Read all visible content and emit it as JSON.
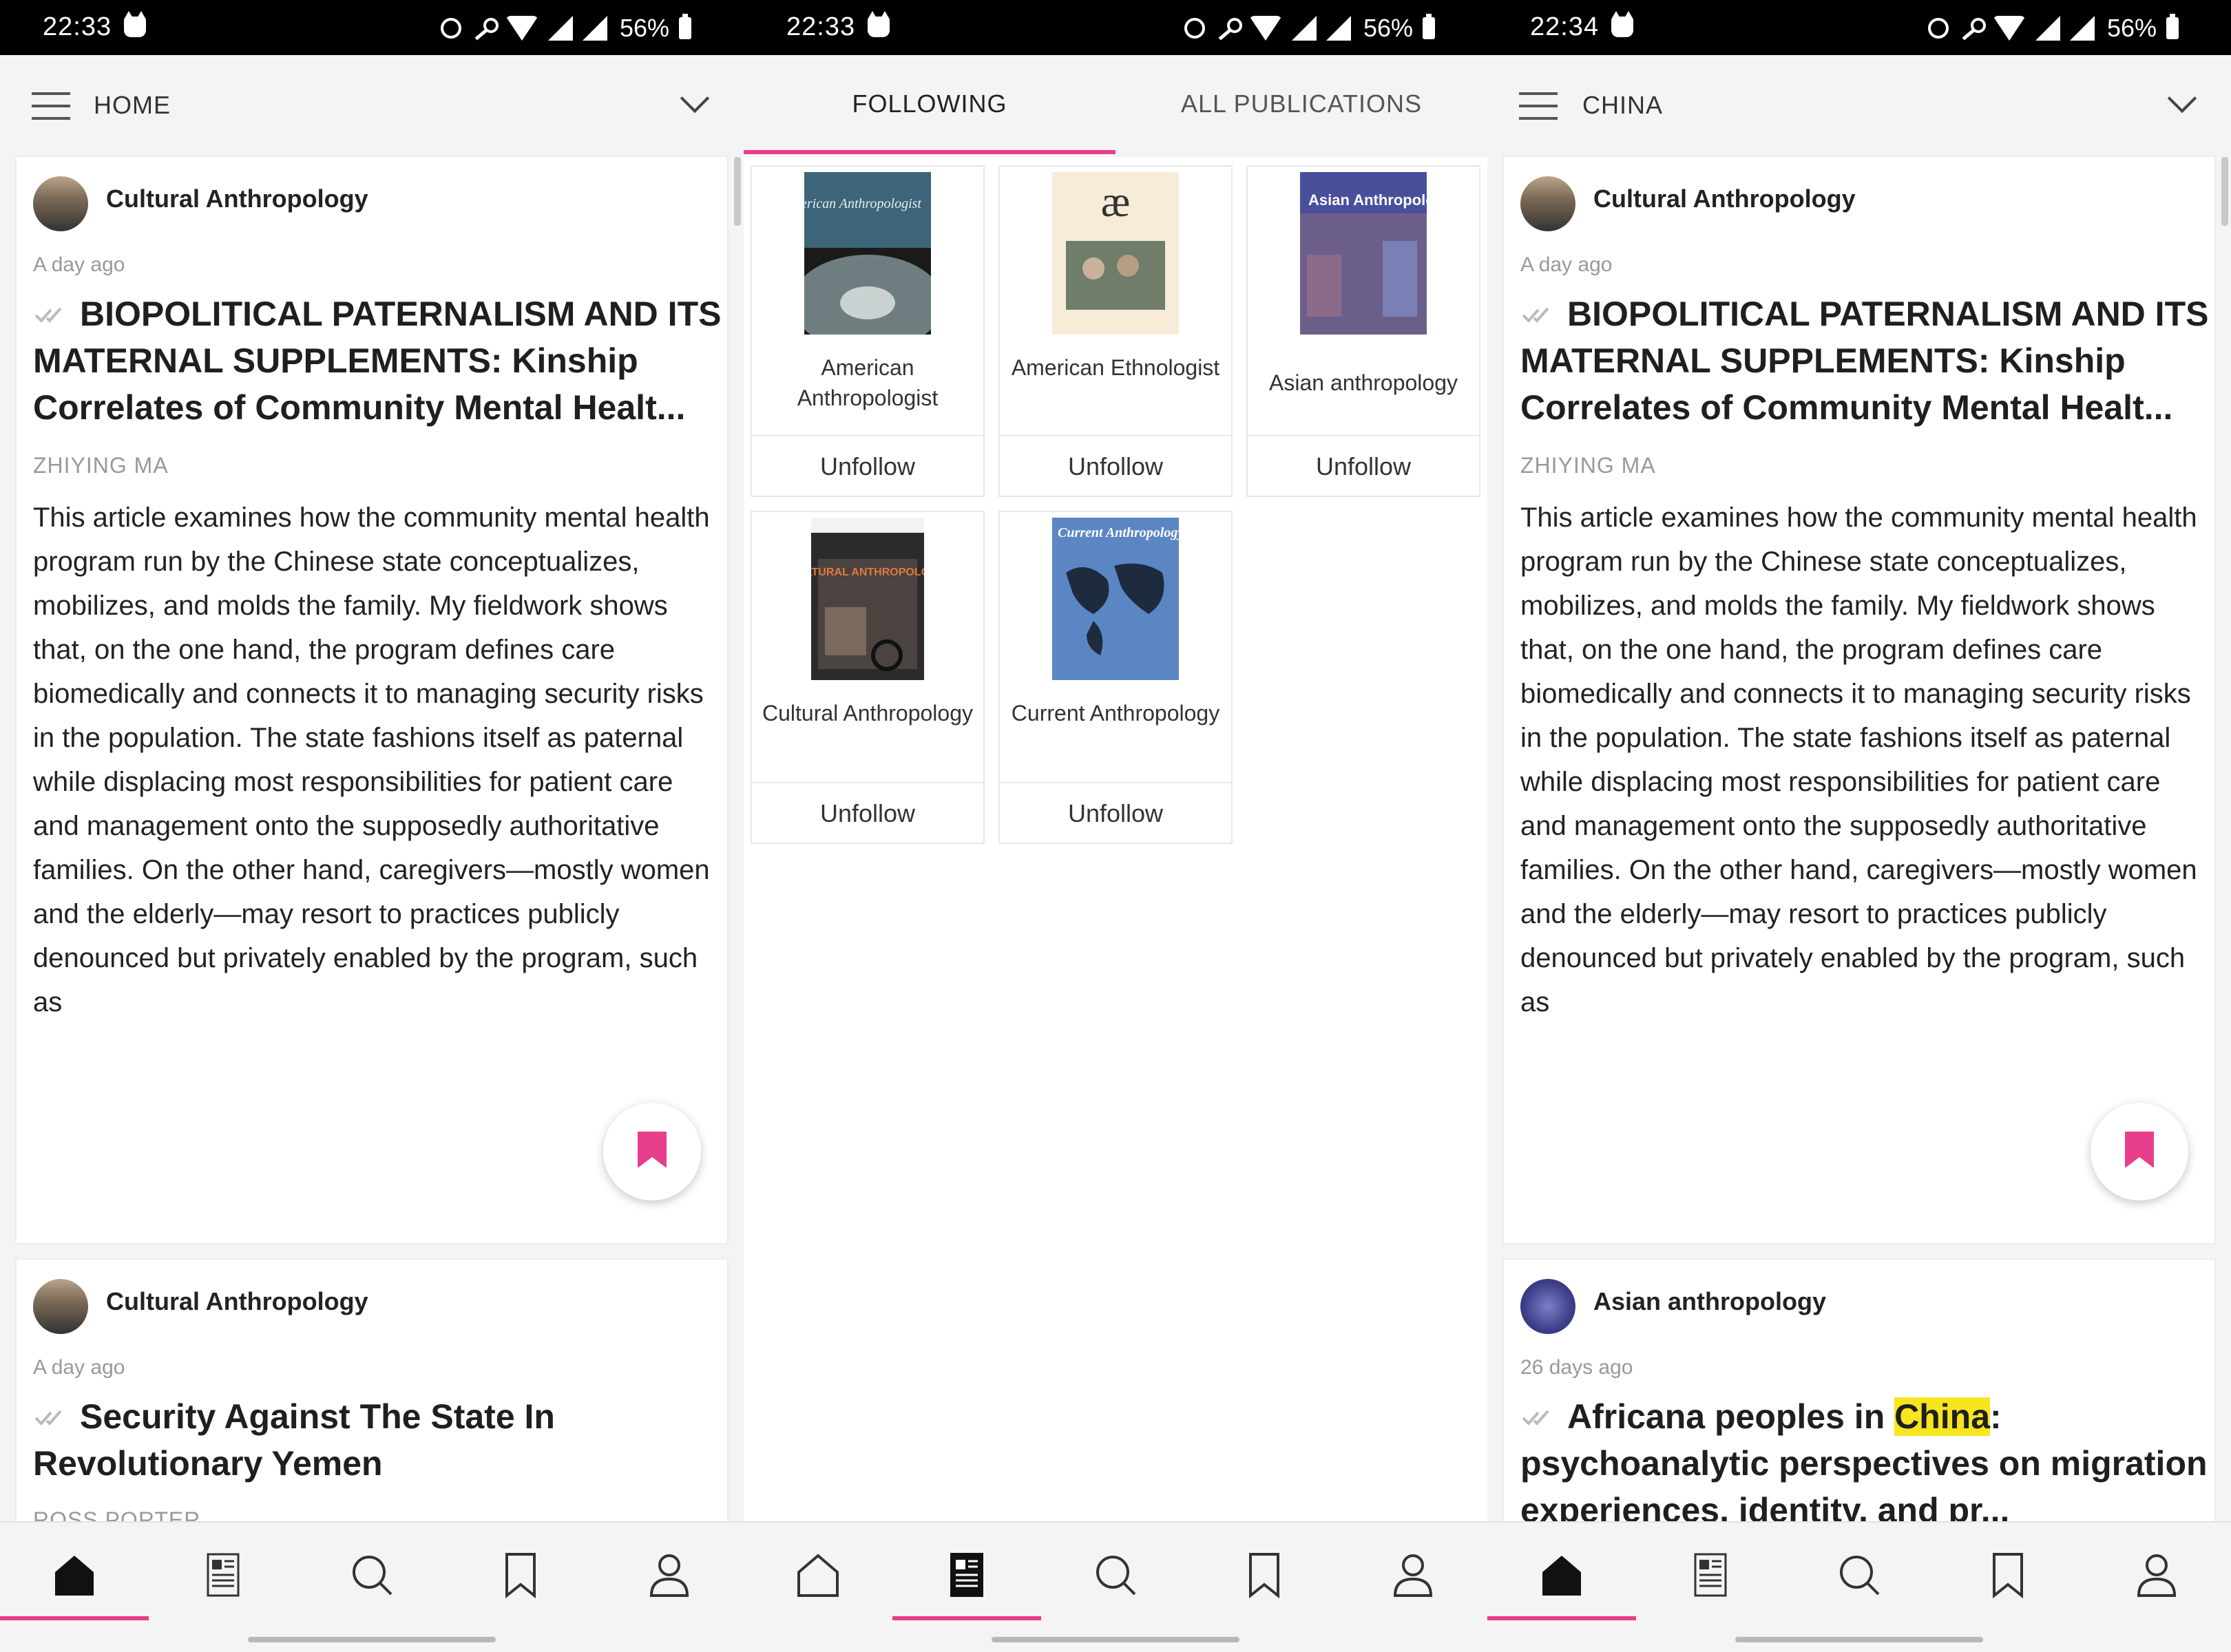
{
  "panel1": {
    "status": {
      "time": "22:33",
      "battery": "56%"
    },
    "appbar": {
      "title": "HOME"
    },
    "card1": {
      "publication": "Cultural Anthropology",
      "age": "A day ago",
      "title": "BIOPOLITICAL PATERNALISM AND ITS MATERNAL SUPPLEMENTS: Kinship Correlates of Community Mental Healt...",
      "author": "ZHIYING MA",
      "abstract": "This article examines how the community mental health program run by the Chinese state conceptualizes, mobilizes, and molds the family. My fieldwork shows that, on the one hand, the program defines care biomedically and connects it to managing security risks in the population. The state fashions itself as paternal while displacing most responsibilities for patient care and management onto the supposedly authoritative families. On the other hand, caregivers—mostly women and the elderly—may resort to practices publicly denounced but privately enabled by the program, such as"
    },
    "card2": {
      "publication": "Cultural Anthropology",
      "age": "A day ago",
      "title": "Security Against The State In Revolutionary Yemen",
      "author": "ROSS PORTER"
    },
    "nav_selected": "home"
  },
  "panel2": {
    "status": {
      "time": "22:33",
      "battery": "56%"
    },
    "tabs": {
      "following": "FOLLOWING",
      "all": "ALL PUBLICATIONS"
    },
    "tiles": [
      {
        "name": "American Anthropologist",
        "cover_text": "American Anthropologist",
        "action": "Unfollow"
      },
      {
        "name": "American Ethnologist",
        "cover_text": "æ",
        "action": "Unfollow"
      },
      {
        "name": "Asian anthropology",
        "cover_text": "Asian Anthropology",
        "action": "Unfollow"
      },
      {
        "name": "Cultural Anthropology",
        "cover_text": "CULTURAL ANTHROPOLOGY",
        "action": "Unfollow"
      },
      {
        "name": "Current Anthropology",
        "cover_text": "Current Anthropology",
        "action": "Unfollow"
      }
    ],
    "nav_selected": "publications"
  },
  "panel3": {
    "status": {
      "time": "22:34",
      "battery": "56%"
    },
    "appbar": {
      "title": "CHINA"
    },
    "card1": {
      "publication": "Cultural Anthropology",
      "age": "A day ago",
      "title": "BIOPOLITICAL PATERNALISM AND ITS MATERNAL SUPPLEMENTS: Kinship Correlates of Community Mental Healt...",
      "author": "ZHIYING MA",
      "abstract": "This article examines how the community mental health program run by the Chinese state conceptualizes, mobilizes, and molds the family. My fieldwork shows that, on the one hand, the program defines care biomedically and connects it to managing security risks in the population. The state fashions itself as paternal while displacing most responsibilities for patient care and management onto the supposedly authoritative families. On the other hand, caregivers—mostly women and the elderly—may resort to practices publicly denounced but privately enabled by the program, such as"
    },
    "card2": {
      "publication": "Asian anthropology",
      "age": "26 days ago",
      "title_pre": "Africana peoples in ",
      "title_highlight": "China",
      "title_post": ": psychoanalytic perspectives on migration experiences, identity, and pr..."
    },
    "nav_selected": "home"
  },
  "colors": {
    "accent": "#e83e8c",
    "highlight": "#f7e51f"
  },
  "icons": [
    "home-icon",
    "publications-icon",
    "search-icon",
    "bookmark-icon",
    "profile-icon",
    "menu-icon",
    "chevron-down-icon",
    "read-check-icon"
  ]
}
